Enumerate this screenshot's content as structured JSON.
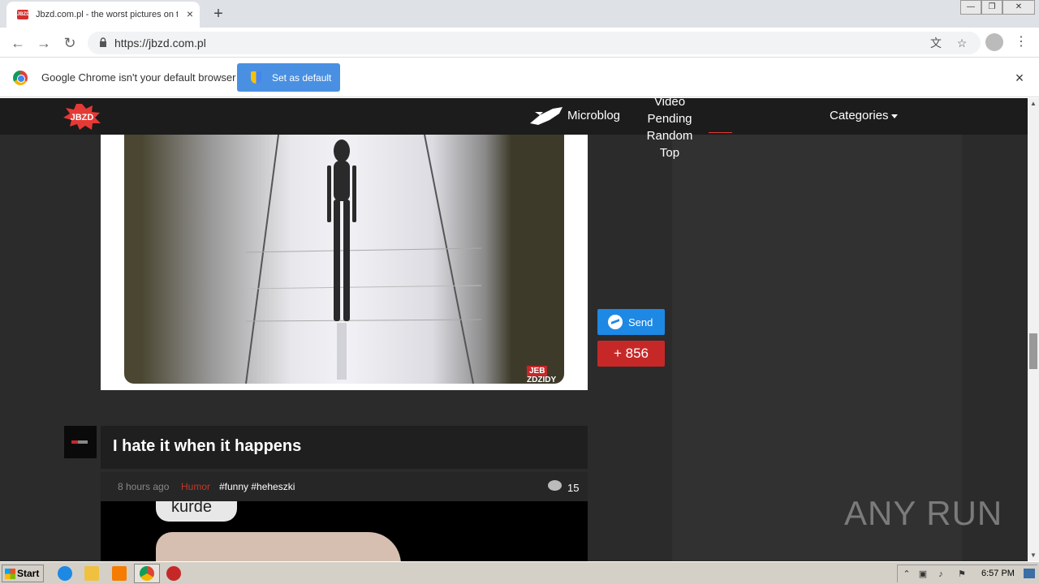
{
  "browser": {
    "tab_title": "Jbzd.com.pl - the worst pictures on the internet",
    "tab_favicon_text": "JBZD",
    "tab_close": "×",
    "new_tab": "+",
    "url": "https://jbzd.com.pl",
    "window_controls": [
      "—",
      "❐",
      "✕"
    ]
  },
  "infobar": {
    "message": "Google Chrome isn't your default browser",
    "set_default_label": "Set as default",
    "close": "×"
  },
  "site": {
    "logo_text": "JBZD",
    "nav": {
      "microblog": "Microblog",
      "stack": [
        "Video",
        "Pending",
        "Random",
        "Top"
      ],
      "categories": "Categories"
    }
  },
  "post1": {
    "watermark_left": "JEB",
    "watermark_right": "ZDZIDY"
  },
  "actions": {
    "send_label": "Send",
    "vote_label": "+ 856"
  },
  "post2": {
    "title": "I hate it when it happens",
    "time": "8 hours ago",
    "category": "Humor",
    "tags": "#funny #heheszki",
    "comments": "15",
    "image_text": "kurde"
  },
  "watermark": "ANY RUN",
  "taskbar": {
    "start": "Start",
    "clock": "6:57 PM"
  },
  "colors": {
    "site_bg": "#2b2b2b",
    "nav_bg": "#1c1c1c",
    "accent_red": "#c62828",
    "messenger_blue": "#1e88e5",
    "infobar_button": "#4a90e2"
  }
}
